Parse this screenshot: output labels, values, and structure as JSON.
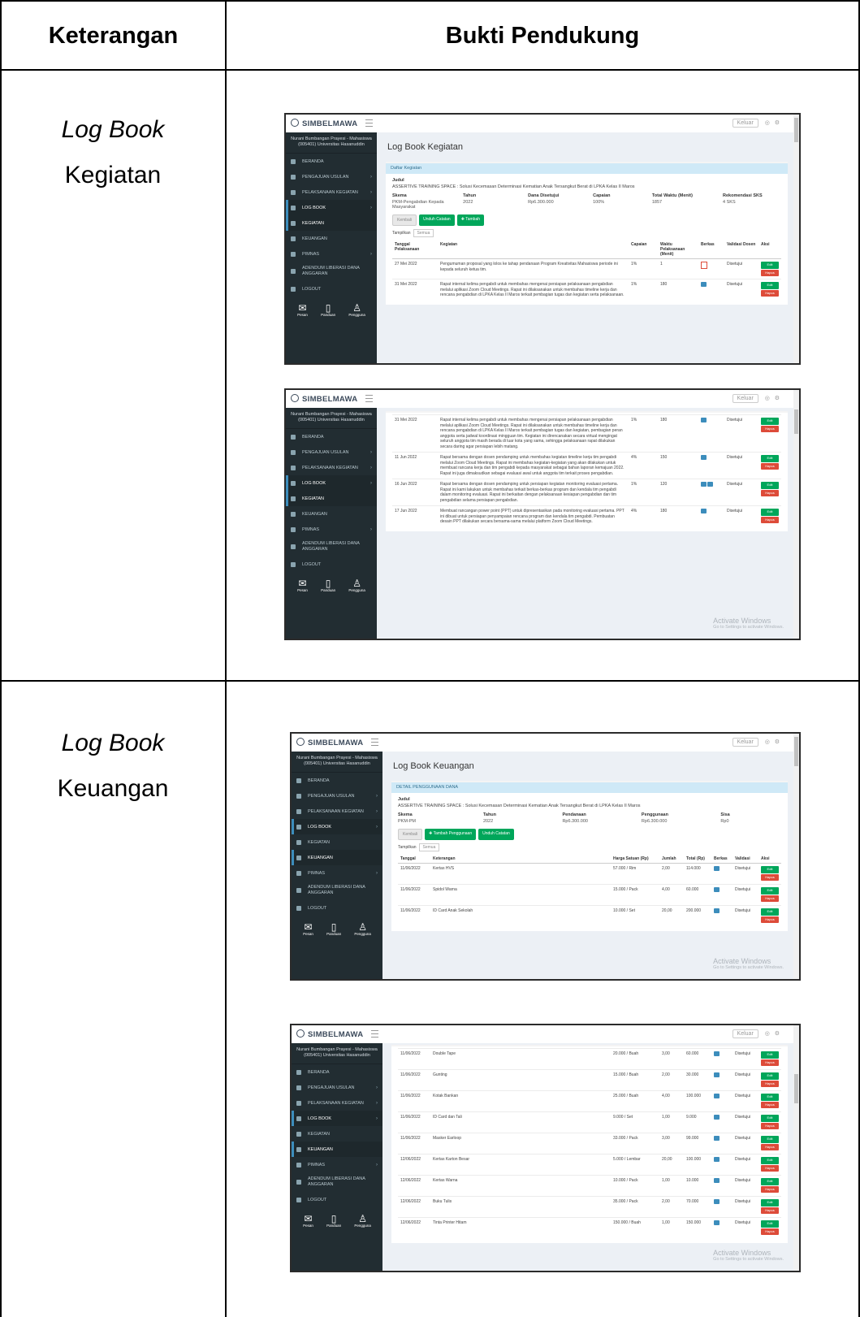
{
  "table_headers": {
    "col1": "Keterangan",
    "col2": "Bukti Pendukung"
  },
  "rows": [
    {
      "italic": "Log Book",
      "normal": "Kegiatan"
    },
    {
      "italic": "Log Book",
      "normal": "Keuangan"
    }
  ],
  "app": {
    "brand": "SIMBELMAWA",
    "org_name": "Nurani Bumbangan Prayesi - Mahasiswa (005401) Universitas Hasanuddin",
    "topbar_button": "Keluar",
    "menu": [
      "BERANDA",
      "PENGAJUAN USULAN",
      "PELAKSANAAN KEGIATAN",
      "LOG BOOK",
      "KEGIATAN",
      "KEUANGAN",
      "PIMNAS",
      "ADENDUM LIBERASI DANA ANGGARAN"
    ],
    "logout": "LOGOUT",
    "bottom_icons": [
      "Pesan",
      "Panduan",
      "Pengguna"
    ],
    "watermark_title": "Activate Windows",
    "watermark_sub": "Go to Settings to activate Windows."
  },
  "kegiatan": {
    "page_title": "Log Book Kegiatan",
    "box_title": "Daftar Kegiatan",
    "judul_label": "Judul",
    "judul": "ASSERTIVE TRAINING SPACE : Solusi Kecemasan Determinasi Kematian Anak Tersangkut Berat di LPKA Kelas II Maros",
    "info_headers": [
      "Skema",
      "Tahun",
      "Dana Disetujui",
      "Capaian",
      "Total Waktu (Menit)",
      "Rekomendasi SKS"
    ],
    "info_values": [
      "PKM-Pengabdian Kepada Masyarakat",
      "2022",
      "Rp6.300.000",
      "100%",
      "1857",
      "4 SKS"
    ],
    "buttons": [
      "Kembali",
      "Unduh Catatan",
      "Tambah"
    ],
    "show_label": "Tampilkan",
    "show_value": "Semua",
    "table_headers": [
      "Tanggal Pelaksanaan",
      "Kegiatan",
      "Capaian",
      "Waktu Pelaksanaan (Menit)",
      "Berkas",
      "Validasi Dosen",
      "Aksi"
    ],
    "rows_a": [
      {
        "date": "27 Mei 2022",
        "text": "Pengumuman proposal yang lolos ke tahap pendanaan Program Kreativitas Mahasiswa periode ini kepada seluruh ketua tim.",
        "capaian": "1%",
        "waktu": "1",
        "validasi": "Disetujui"
      },
      {
        "date": "31 Mei 2022",
        "text": "Rapat internal kelima pengabdi untuk membahas mengenai persiapan pelaksanaan pengabdian melalui aplikasi Zoom Cloud Meetings. Rapat ini dilaksanakan untuk membahas timeline kerja dan rencana pengabdian di LPKA Kelas II Maros terkait pembagian tugas dan kegiatan serta pelaksanaan.",
        "capaian": "1%",
        "waktu": "180",
        "validasi": "Disetujui"
      }
    ],
    "rows_b": [
      {
        "date": "31 Mei 2022",
        "text": "Rapat internal kelima pengabdi untuk membahas mengenai persiapan pelaksanaan pengabdian melalui aplikasi Zoom Cloud Meetings. Rapat ini dilaksanakan untuk membahas timeline kerja dan rencana pengabdian di LPKA Kelas II Maros terkait pembagian tugas dan kegiatan, pembagian peran anggota serta jadwal koordinasi mingguan tim. Kegiatan ini direncanakan secara virtual mengingat seluruh anggota tim masih berada di luar kota yang sama, sehingga pelaksanaan rapat dilakukan secara daring agar persiapan lebih matang.",
        "capaian": "1%",
        "waktu": "180",
        "validasi": "Disetujui"
      },
      {
        "date": "11 Jun 2022",
        "text": "Rapat bersama dengan dosen pendamping untuk membahas kegiatan timeline kerja tim pengabdi melalui Zoom Cloud Meetings. Rapat ini membahas kegiatan-kegiatan yang akan dilakukan untuk membuat rancana kerja dan tim pengabdi kepada masyarakat sebagai bahan laporan kemajuan 2022. Rapat ini juga dimaksudkan sebagai evaluasi awal untuk anggota tim terkait proses pengabdian.",
        "capaian": "4%",
        "waktu": "150",
        "validasi": "Disetujui"
      },
      {
        "date": "16 Jun 2022",
        "text": "Rapat bersama dengan dosen pendamping untuk persiapan kegiatan monitoring evaluasi pertama. Rapat ini kami lakukan untuk membahas terkait berkas-berkas program dan kendala tim pengabdi dalam monitoring evaluasi. Rapat ini berkaitan dengan pelaksanaan kesiapan pengabdian dan tim pengabdian selama persiapan pengabdian.",
        "capaian": "1%",
        "waktu": "120",
        "validasi": "Disetujui"
      },
      {
        "date": "17 Jun 2022",
        "text": "Membuat rancangan power point (PPT) untuk dipresentasikan pada monitoring evaluasi pertama. PPT ini dibuat untuk persiapan penyampaian rencana program dan kendala tim pengabdi. Pembuatan desain PPT dilakukan secara bersama-sama melalui platform Zoom Cloud Meetings.",
        "capaian": "4%",
        "waktu": "180",
        "validasi": "Disetujui"
      }
    ]
  },
  "keuangan": {
    "page_title": "Log Book Keuangan",
    "box_title": "DETAIL PENGGUNAAN DANA",
    "judul_label": "Judul",
    "judul": "ASSERTIVE TRAINING SPACE : Solusi Kecemasan Determinasi Kematian Anak Tersangkut Berat di LPKA Kelas II Maros",
    "info_headers": [
      "Skema",
      "Tahun",
      "Pendanaan",
      "Penggunaan",
      "Sisa"
    ],
    "info_values": [
      "PKM-PM",
      "2022",
      "Rp6.300.000",
      "Rp6.300.000",
      "Rp0"
    ],
    "buttons": [
      "Kembali",
      "Tambah Penggunaan",
      "Unduh Catatan"
    ],
    "show_label": "Tampilkan",
    "show_value": "Semua",
    "table_headers": [
      "Tanggal",
      "Keterangan",
      "Harga Satuan (Rp)",
      "Jumlah",
      "Total (Rp)",
      "Berkas",
      "Validasi",
      "Aksi"
    ],
    "rows_a": [
      {
        "date": "11/06/2022",
        "ket": "Kertas HVS",
        "harga": "57.000 / Rim",
        "jml": "2,00",
        "total": "114.000",
        "val": "Disetujui"
      },
      {
        "date": "11/06/2022",
        "ket": "Spidol Warna",
        "harga": "15.000 / Pack",
        "jml": "4,00",
        "total": "60.000",
        "val": "Disetujui"
      },
      {
        "date": "11/06/2022",
        "ket": "ID Card Anak Sekolah",
        "harga": "10.000 / Set",
        "jml": "20,00",
        "total": "200.000",
        "val": "Disetujui"
      }
    ],
    "rows_b": [
      {
        "date": "11/06/2022",
        "ket": "Double Tape",
        "harga": "20.000 / Buah",
        "jml": "3,00",
        "total": "60.000",
        "val": "Disetujui"
      },
      {
        "date": "11/06/2022",
        "ket": "Gunting",
        "harga": "15.000 / Buah",
        "jml": "2,00",
        "total": "30.000",
        "val": "Disetujui"
      },
      {
        "date": "11/06/2022",
        "ket": "Kotak Bankan",
        "harga": "25.000 / Buah",
        "jml": "4,00",
        "total": "100.000",
        "val": "Disetujui"
      },
      {
        "date": "11/06/2022",
        "ket": "ID Card dan Tali",
        "harga": "9.000 / Set",
        "jml": "1,00",
        "total": "9.000",
        "val": "Disetujui"
      },
      {
        "date": "11/06/2022",
        "ket": "Masker Earloop",
        "harga": "33.000 / Pack",
        "jml": "3,00",
        "total": "99.000",
        "val": "Disetujui"
      },
      {
        "date": "12/06/2022",
        "ket": "Kertas Karton Besar",
        "harga": "5.000 / Lembar",
        "jml": "20,00",
        "total": "100.000",
        "val": "Disetujui"
      },
      {
        "date": "12/06/2022",
        "ket": "Kertas Warna",
        "harga": "10.000 / Pack",
        "jml": "1,00",
        "total": "10.000",
        "val": "Disetujui"
      },
      {
        "date": "12/06/2022",
        "ket": "Buku Tulis",
        "harga": "35.000 / Pack",
        "jml": "2,00",
        "total": "70.000",
        "val": "Disetujui"
      },
      {
        "date": "12/06/2022",
        "ket": "Tinta Printer Hitam",
        "harga": "150.000 / Buah",
        "jml": "1,00",
        "total": "150.000",
        "val": "Disetujui"
      }
    ]
  },
  "action_labels": {
    "edit": "Edit",
    "delete": "Hapus"
  }
}
